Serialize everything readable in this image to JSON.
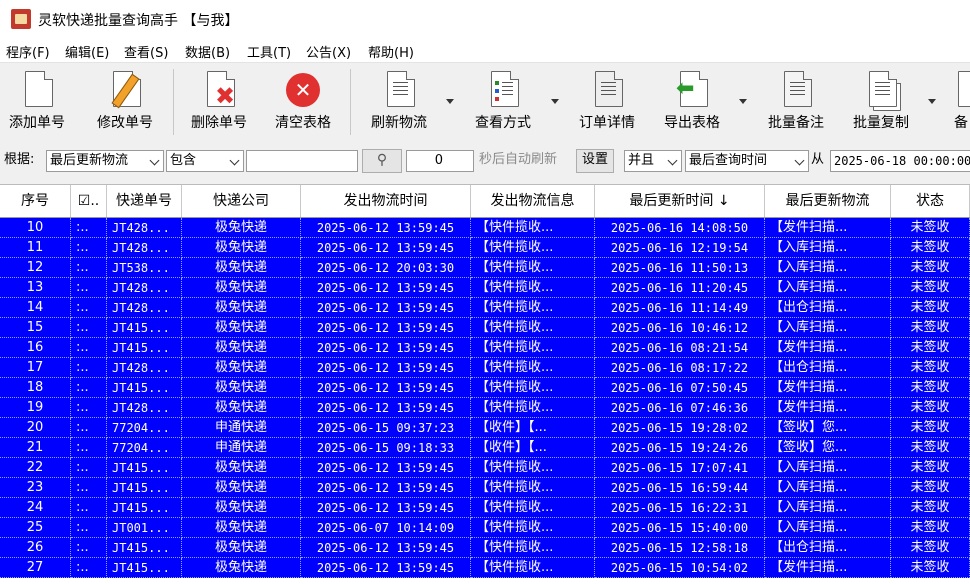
{
  "window": {
    "title": "灵软快递批量查询高手 【与我】"
  },
  "menu": [
    "程序(F)",
    "编辑(E)",
    "查看(S)",
    "数据(B)",
    "工具(T)",
    "公告(X)",
    "帮助(H)"
  ],
  "toolbar": {
    "add": "添加单号",
    "edit": "修改单号",
    "delete": "删除单号",
    "clear": "清空表格",
    "refresh": "刷新物流",
    "view": "查看方式",
    "detail": "订单详情",
    "export": "导出表格",
    "batch_note": "批量备注",
    "batch_copy": "批量复制",
    "cut": "备"
  },
  "filter": {
    "label": "根据:",
    "field": "最后更新物流",
    "op": "包含",
    "value": "",
    "seconds": "0",
    "auto_text": "秒后自动刷新",
    "settings": "设置",
    "logic": "并且",
    "field2": "最后查询时间",
    "from": "从",
    "date": "2025-06-18 00:00:00"
  },
  "table": {
    "headers": [
      "序号",
      "☑..",
      "快递单号",
      "快递公司",
      "发出物流时间",
      "发出物流信息",
      "最后更新时间 ↓",
      "最后更新物流",
      "状态"
    ],
    "rows": [
      [
        "10",
        ":..",
        "JT428...",
        "极兔快递",
        "2025-06-12 13:59:45",
        "【快件揽收...",
        "2025-06-16 14:08:50",
        "【发件扫描...",
        "未签收"
      ],
      [
        "11",
        ":..",
        "JT428...",
        "极兔快递",
        "2025-06-12 13:59:45",
        "【快件揽收...",
        "2025-06-16 12:19:54",
        "【入库扫描...",
        "未签收"
      ],
      [
        "12",
        ":..",
        "JT538...",
        "极兔快递",
        "2025-06-12 20:03:30",
        "【快件揽收...",
        "2025-06-16 11:50:13",
        "【入库扫描...",
        "未签收"
      ],
      [
        "13",
        ":..",
        "JT428...",
        "极兔快递",
        "2025-06-12 13:59:45",
        "【快件揽收...",
        "2025-06-16 11:20:45",
        "【入库扫描...",
        "未签收"
      ],
      [
        "14",
        ":..",
        "JT428...",
        "极兔快递",
        "2025-06-12 13:59:45",
        "【快件揽收...",
        "2025-06-16 11:14:49",
        "【出仓扫描...",
        "未签收"
      ],
      [
        "15",
        ":..",
        "JT415...",
        "极兔快递",
        "2025-06-12 13:59:45",
        "【快件揽收...",
        "2025-06-16 10:46:12",
        "【入库扫描...",
        "未签收"
      ],
      [
        "16",
        ":..",
        "JT415...",
        "极兔快递",
        "2025-06-12 13:59:45",
        "【快件揽收...",
        "2025-06-16 08:21:54",
        "【发件扫描...",
        "未签收"
      ],
      [
        "17",
        ":..",
        "JT428...",
        "极兔快递",
        "2025-06-12 13:59:45",
        "【快件揽收...",
        "2025-06-16 08:17:22",
        "【出仓扫描...",
        "未签收"
      ],
      [
        "18",
        ":..",
        "JT415...",
        "极兔快递",
        "2025-06-12 13:59:45",
        "【快件揽收...",
        "2025-06-16 07:50:45",
        "【发件扫描...",
        "未签收"
      ],
      [
        "19",
        ":..",
        "JT428...",
        "极兔快递",
        "2025-06-12 13:59:45",
        "【快件揽收...",
        "2025-06-16 07:46:36",
        "【发件扫描...",
        "未签收"
      ],
      [
        "20",
        ":..",
        "77204...",
        "申通快递",
        "2025-06-15 09:37:23",
        "【收件】【...",
        "2025-06-15 19:28:02",
        "【签收】您...",
        "未签收"
      ],
      [
        "21",
        ":..",
        "77204...",
        "申通快递",
        "2025-06-15 09:18:33",
        "【收件】【...",
        "2025-06-15 19:24:26",
        "【签收】您...",
        "未签收"
      ],
      [
        "22",
        ":..",
        "JT415...",
        "极兔快递",
        "2025-06-12 13:59:45",
        "【快件揽收...",
        "2025-06-15 17:07:41",
        "【入库扫描...",
        "未签收"
      ],
      [
        "23",
        ":..",
        "JT415...",
        "极兔快递",
        "2025-06-12 13:59:45",
        "【快件揽收...",
        "2025-06-15 16:59:44",
        "【入库扫描...",
        "未签收"
      ],
      [
        "24",
        ":..",
        "JT415...",
        "极兔快递",
        "2025-06-12 13:59:45",
        "【快件揽收...",
        "2025-06-15 16:22:31",
        "【入库扫描...",
        "未签收"
      ],
      [
        "25",
        ":..",
        "JT001...",
        "极兔快递",
        "2025-06-07 10:14:09",
        "【快件揽收...",
        "2025-06-15 15:40:00",
        "【入库扫描...",
        "未签收"
      ],
      [
        "26",
        ":..",
        "JT415...",
        "极兔快递",
        "2025-06-12 13:59:45",
        "【快件揽收...",
        "2025-06-15 12:58:18",
        "【出仓扫描...",
        "未签收"
      ],
      [
        "27",
        ":..",
        "JT415...",
        "极兔快递",
        "2025-06-12 13:59:45",
        "【快件揽收...",
        "2025-06-15 10:54:02",
        "【发件扫描...",
        "未签收"
      ]
    ]
  },
  "colors": {
    "selection": "#0000ff",
    "danger": "#e03030"
  }
}
